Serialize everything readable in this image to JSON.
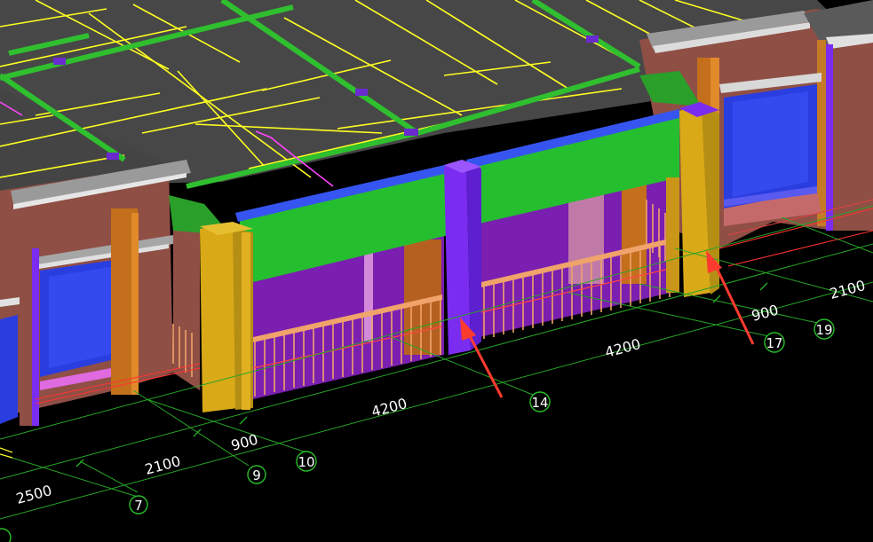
{
  "viewport": {
    "title": "",
    "colors": {
      "background": "#000000",
      "slab": "#474747",
      "beam_green": "#25be2f",
      "column_yellow": "#d9a918",
      "column_purple": "#7a2cf0",
      "wall_brown": "#8f4f45",
      "window_blue": "#2a3ee0",
      "railing_orange": "#f0a36a",
      "grid_line": "#ffff22",
      "axis_line": "#27a527",
      "marker_red": "#ff3b30"
    }
  },
  "dimensions": {
    "d_2500": "2500",
    "d_2100_left": "2100",
    "d_900_left": "900",
    "d_4200_left": "4200",
    "d_4200_right": "4200",
    "d_900_right": "900",
    "d_2100_right": "2100"
  },
  "axes": {
    "a7": "7",
    "a9": "9",
    "a10": "10",
    "a14": "14",
    "a17": "17",
    "a19": "19"
  },
  "markers": [
    {
      "name": "arrow-to-column-14",
      "icon": "red-arrow-icon"
    },
    {
      "name": "arrow-to-column-17",
      "icon": "red-arrow-icon"
    }
  ]
}
